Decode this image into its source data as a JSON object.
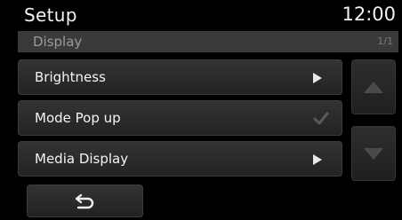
{
  "header": {
    "title": "Setup",
    "clock": "12:00"
  },
  "subheader": {
    "title": "Display",
    "page_indicator": "1/1"
  },
  "menu": {
    "items": [
      {
        "label": "Brightness",
        "control": "arrow"
      },
      {
        "label": "Mode Pop up",
        "control": "checkbox",
        "checked": true
      },
      {
        "label": "Media Display",
        "control": "arrow"
      }
    ]
  },
  "scroll": {
    "up_icon": "triangle-up-icon",
    "down_icon": "triangle-down-icon"
  },
  "back": {
    "icon": "back-arrow-icon"
  },
  "colors": {
    "background": "#000000",
    "item": "#2b2b2b",
    "text": "#f5f5f5",
    "muted": "#9a9a9a"
  }
}
